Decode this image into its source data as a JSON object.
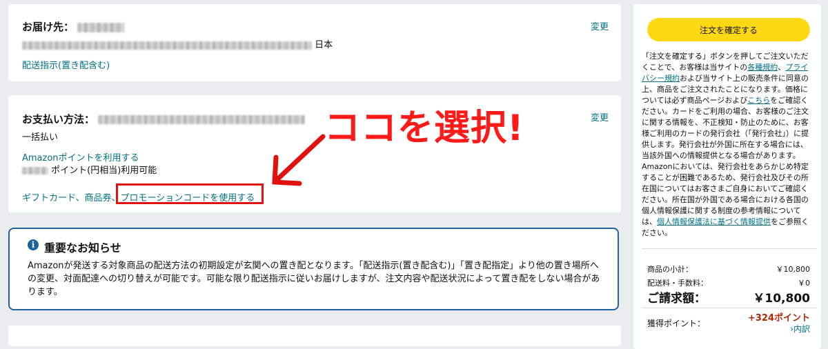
{
  "address": {
    "title": "お届け先：",
    "country": "日本",
    "change": "変更",
    "delivery_instruction": "配送指示(置き配含む)"
  },
  "payment": {
    "title": "お支払い方法：",
    "change": "変更",
    "installment": "一括払い",
    "points_link": "Amazonポイントを利用する",
    "points_available": "ポイント(円相当)利用可能",
    "gift_link": "ギフトカード、商品券、",
    "promo_link": "プロモーションコードを使用する"
  },
  "annotation": {
    "text": "ココを選択!",
    "color": "#ff1a1a"
  },
  "notice": {
    "icon": "i",
    "title": "重要なお知らせ",
    "body": "Amazonが発送する対象商品の配送方法の初期設定が玄関への置き配となります。「配送指示(置き配含む)」「置き配指定」より他の置き場所への変更、対面配達への切り替えが可能です。可能な限り配送指示に従いお届けしますが、注文内容や配送状況によって置き配をしない場合があります。"
  },
  "order_panel": {
    "place_order": "注文を確定する",
    "disclaimer": {
      "p1": "「注文を確定する」ボタンを押してご注文いただくことで、お客様は当サイトの",
      "link_terms": "各種規約",
      "p2": "、",
      "link_privacy": "プライバシー規約",
      "p3": "および当サイト上の販売条件に同意の上、商品をご注文されたことになります。価格については必ず商品ページおよび",
      "link_here": "こちら",
      "p4": "をご確認ください。カードをご利用の場合、お客様のご注文に関する情報を、不正検知・防止のために、お客様ご利用のカードの発行会社（「発行会社」）に提供します。発行会社が外国に所在する場合には、当該外国への情報提供となる場合があります。Amazonにおいては、発行会社をあらかじめ特定することが困難であるため、発行会社及びその所在国についてはお客さまご自身においてご確認ください。所在国が外国である場合における各国の個人情報保護に関する制度の参考情報については、",
      "link_pi": "個人情報保護法に基づく情報提供",
      "p5": "をご参照ください。"
    },
    "subtotal_label": "商品の小計：",
    "subtotal_value": "￥10,800",
    "shipping_label": "配送料・手数料：",
    "shipping_value": "￥0",
    "total_label": "ご請求額：",
    "total_value": "￥10,800",
    "points_label": "獲得ポイント：",
    "points_value": "+324ポイント",
    "breakdown": "›内訳"
  }
}
